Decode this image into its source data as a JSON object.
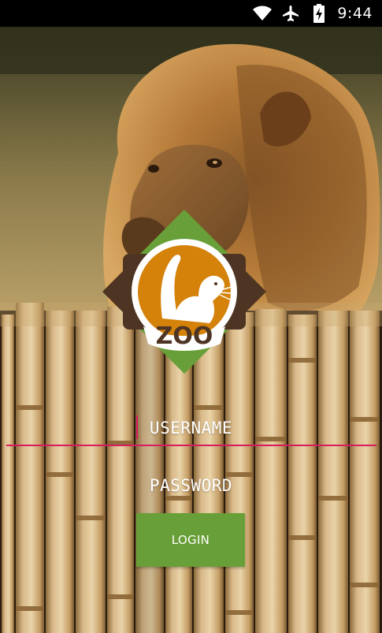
{
  "status_bar": {
    "time": "9:44",
    "icons": [
      "wifi-icon",
      "airplane-mode-icon",
      "battery-charging-icon"
    ]
  },
  "logo": {
    "text": "ZOO",
    "colors": {
      "diamond_green": "#689f38",
      "diamond_brown": "#4e3422",
      "circle_orange": "#d4820a"
    }
  },
  "login_form": {
    "username_placeholder": "USERNAME",
    "password_placeholder": "PASSWORD",
    "login_label": "LOGIN"
  },
  "colors": {
    "accent": "#d81b60",
    "button": "#689f38"
  }
}
